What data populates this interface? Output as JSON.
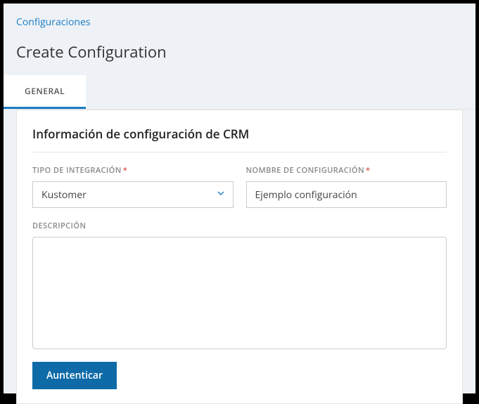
{
  "breadcrumb": {
    "label": "Configuraciones"
  },
  "page": {
    "title": "Create Configuration"
  },
  "tabs": {
    "general": "GENERAL"
  },
  "section": {
    "title": "Información de configuración de CRM"
  },
  "form": {
    "integration_type": {
      "label": "TIPO DE INTEGRACIÓN",
      "required": "*",
      "value": "Kustomer"
    },
    "config_name": {
      "label": "NOMBRE DE CONFIGURACIÓN",
      "required": "*",
      "value": "Ejemplo configuración"
    },
    "description": {
      "label": "DESCRIPCIÓN",
      "value": ""
    }
  },
  "actions": {
    "authenticate": "Auntenticar"
  }
}
